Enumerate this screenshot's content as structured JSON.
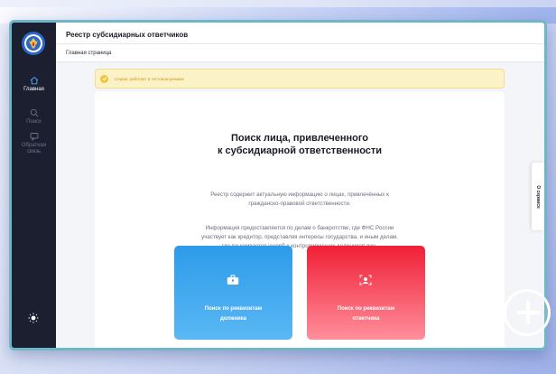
{
  "header": {
    "title": "Реестр субсидиарных ответчиков",
    "breadcrumb": "Главная страница"
  },
  "sidebar": {
    "items": [
      {
        "label": "Главная",
        "icon": "home-icon",
        "active": true
      },
      {
        "label": "Поиск",
        "icon": "search-icon",
        "active": false
      },
      {
        "label": "Обратная связь",
        "icon": "feedback-icon",
        "active": false
      }
    ],
    "theme_icon": "sun-icon"
  },
  "notice": {
    "text": "Сервис работает в тестовом режиме",
    "color": "#fcf2c7"
  },
  "main": {
    "heading_line1": "Поиск лица, привлеченного",
    "heading_line2": "к субсидиарной ответственности",
    "para1_line1": "Реестр содержит актуальную информацию о лицах, привлечённых к",
    "para1_line2": "гражданско-правовой ответственности.",
    "para2_line1": "Информация предоставляется по делам о банкротстве, где ФНС России",
    "para2_line2": "участвует как кредитор, представляя интересы государства, и иным делам,",
    "para2_line3": "где взыскивается ущерб с контролирующих должников лиц."
  },
  "tiles": {
    "debtor": {
      "label": "Поиск по реквизитам\nдолжника",
      "icon": "briefcase-icon",
      "color": "#2d9bea"
    },
    "defendant": {
      "label": "Поиск по реквизитам\nответчика",
      "icon": "face-scan-icon",
      "color": "#f01f36"
    }
  },
  "side_tab": {
    "label": "О сервисе"
  }
}
